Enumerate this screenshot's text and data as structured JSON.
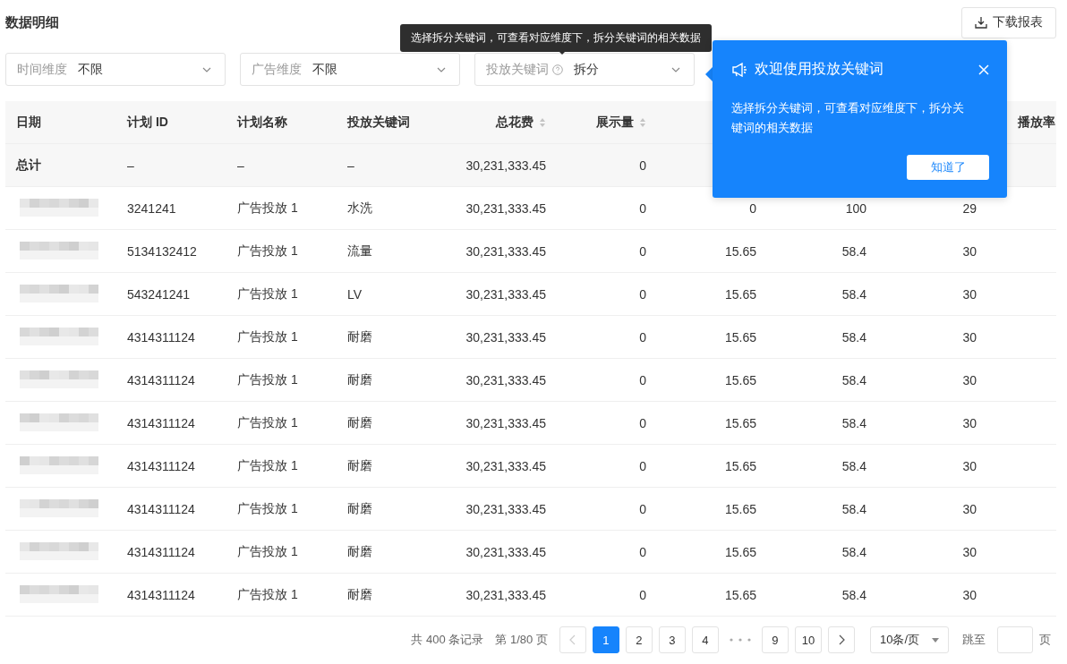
{
  "title": "数据明细",
  "download_button": "下载报表",
  "filters": [
    {
      "label": "时间维度",
      "value": "不限",
      "help": false
    },
    {
      "label": "广告维度",
      "value": "不限",
      "help": false
    },
    {
      "label": "投放关键词",
      "value": "拆分",
      "help": true
    }
  ],
  "tooltip": "选择拆分关键词，可查看对应维度下，拆分关键词的相关数据",
  "popover": {
    "title": "欢迎使用投放关键词",
    "body": "选择拆分关键词，可查看对应维度下，拆分关键词的相关数据",
    "button": "知道了"
  },
  "table": {
    "columns": [
      {
        "label": "日期",
        "sortable": false
      },
      {
        "label": "计划 ID",
        "sortable": false
      },
      {
        "label": "计划名称",
        "sortable": false
      },
      {
        "label": "投放关键词",
        "sortable": false
      },
      {
        "label": "总花费",
        "sortable": true
      },
      {
        "label": "展示量",
        "sortable": true
      },
      {},
      {},
      {},
      {
        "label": "播放率"
      }
    ],
    "total": [
      "总计",
      "–",
      "–",
      "–",
      "30,231,333.45",
      "0"
    ],
    "rows": [
      {
        "cells": [
          "",
          "3241241",
          "广告投放 1",
          "水洗",
          "30,231,333.45",
          "0",
          "0",
          "100",
          "29"
        ]
      },
      {
        "cells": [
          "",
          "5134132412",
          "广告投放 1",
          "流量",
          "30,231,333.45",
          "0",
          "15.65",
          "58.4",
          "30"
        ]
      },
      {
        "cells": [
          "",
          "543241241",
          "广告投放 1",
          "LV",
          "30,231,333.45",
          "0",
          "15.65",
          "58.4",
          "30"
        ]
      },
      {
        "cells": [
          "",
          "4314311124",
          "广告投放 1",
          "耐磨",
          "30,231,333.45",
          "0",
          "15.65",
          "58.4",
          "30"
        ]
      },
      {
        "cells": [
          "",
          "4314311124",
          "广告投放 1",
          "耐磨",
          "30,231,333.45",
          "0",
          "15.65",
          "58.4",
          "30"
        ]
      },
      {
        "cells": [
          "",
          "4314311124",
          "广告投放 1",
          "耐磨",
          "30,231,333.45",
          "0",
          "15.65",
          "58.4",
          "30"
        ]
      },
      {
        "cells": [
          "",
          "4314311124",
          "广告投放 1",
          "耐磨",
          "30,231,333.45",
          "0",
          "15.65",
          "58.4",
          "30"
        ]
      },
      {
        "cells": [
          "",
          "4314311124",
          "广告投放 1",
          "耐磨",
          "30,231,333.45",
          "0",
          "15.65",
          "58.4",
          "30"
        ]
      },
      {
        "cells": [
          "",
          "4314311124",
          "广告投放 1",
          "耐磨",
          "30,231,333.45",
          "0",
          "15.65",
          "58.4",
          "30"
        ]
      },
      {
        "cells": [
          "",
          "4314311124",
          "广告投放 1",
          "耐磨",
          "30,231,333.45",
          "0",
          "15.65",
          "58.4",
          "30"
        ]
      }
    ]
  },
  "pagination": {
    "total": "共 400 条记录",
    "page_info": "第 1/80 页",
    "pages": [
      {
        "label": "1",
        "selected": true
      },
      {
        "label": "2",
        "selected": false
      },
      {
        "label": "3",
        "selected": false
      },
      {
        "label": "4",
        "selected": false
      },
      {
        "kind": "ellipsis"
      },
      {
        "label": "9",
        "selected": false
      },
      {
        "label": "10",
        "selected": false
      }
    ],
    "page_size": "10条/页",
    "jump_label": "跳至",
    "jump_suffix": "页"
  }
}
